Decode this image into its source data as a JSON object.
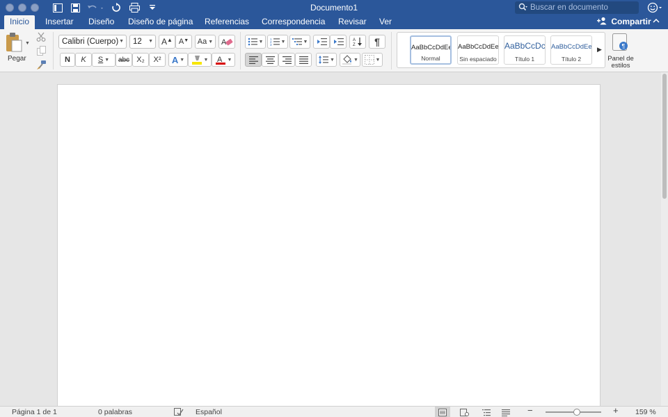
{
  "window": {
    "title": "Documento1",
    "search_placeholder": "Buscar en documento"
  },
  "tabs": [
    {
      "label": "Inicio"
    },
    {
      "label": "Insertar"
    },
    {
      "label": "Diseño"
    },
    {
      "label": "Diseño de página"
    },
    {
      "label": "Referencias"
    },
    {
      "label": "Correspondencia"
    },
    {
      "label": "Revisar"
    },
    {
      "label": "Ver"
    }
  ],
  "share_label": "Compartir",
  "clipboard": {
    "paste_label": "Pegar"
  },
  "font": {
    "name": "Calibri (Cuerpo)",
    "size": "12",
    "bold": "N",
    "italic": "K",
    "underline": "S",
    "strikethrough": "abc",
    "subscript": "X₂",
    "superscript": "X²"
  },
  "styles": [
    {
      "sample": "AaBbCcDdEe",
      "name": "Normal"
    },
    {
      "sample": "AaBbCcDdEe",
      "name": "Sin espaciado"
    },
    {
      "sample": "AaBbCcDc",
      "name": "Título 1"
    },
    {
      "sample": "AaBbCcDdEe",
      "name": "Título 2"
    }
  ],
  "styles_pane_label_1": "Panel de",
  "styles_pane_label_2": "estilos",
  "status": {
    "page": "Página 1 de 1",
    "words": "0 palabras",
    "language": "Español",
    "zoom": "159 %",
    "zoom_minus": "−",
    "zoom_plus": "+"
  },
  "colors": {
    "accent": "#2b579a",
    "highlight": "#f7e600",
    "font_color": "#d80000"
  }
}
